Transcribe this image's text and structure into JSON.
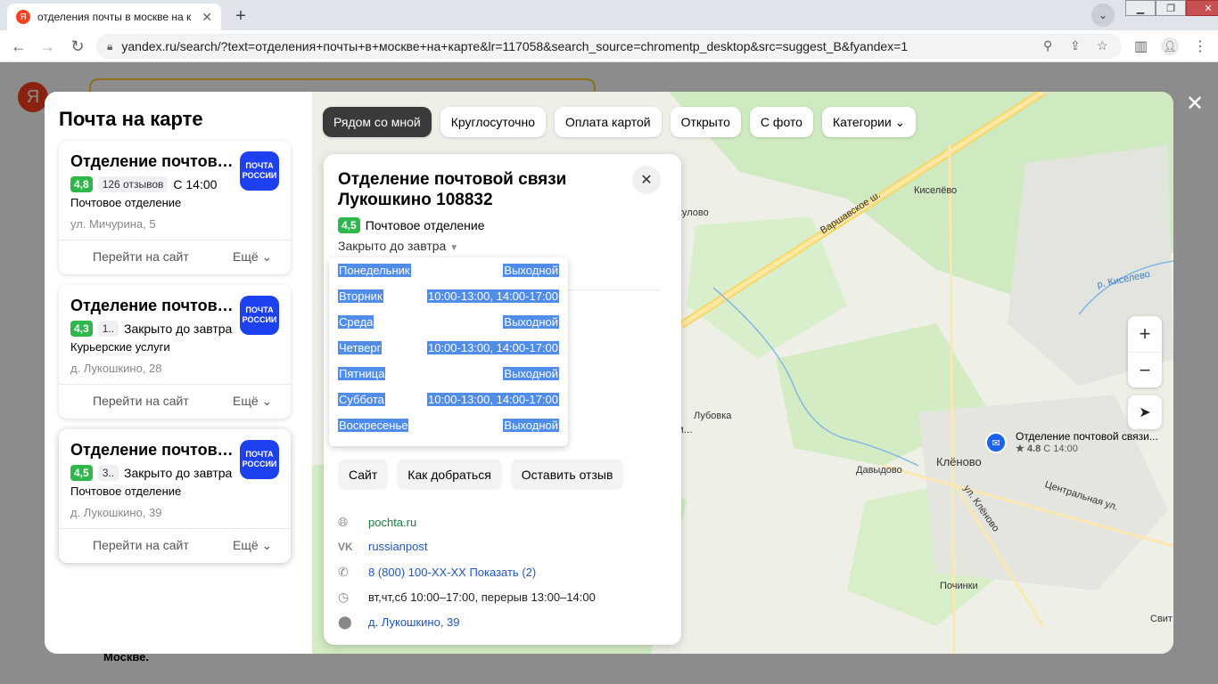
{
  "browser": {
    "tab_title": "отделения почты в москве на к",
    "tab_favicon": "Я",
    "url": "yandex.ru/search/?text=отделения+почты+в+москве+на+карте&lr=117058&search_source=chromentp_desktop&src=suggest_B&fyandex=1"
  },
  "page": {
    "logo": "Я",
    "bottom_text": "Москве."
  },
  "sidebar": {
    "title": "Почта на карте",
    "cards": [
      {
        "title": "Отделение почтовой связи",
        "rating": "4,8",
        "reviews": "126 отзывов",
        "status": "С 14:00",
        "category": "Почтовое отделение",
        "address": "ул. Мичурина, 5",
        "site": "Перейти на сайт",
        "more": "Ещё"
      },
      {
        "title": "Отделение почтовой связи",
        "rating": "4,3",
        "reviews": "1..",
        "status": "Закрыто до завтра",
        "category": "Курьерские услуги",
        "address": "д. Лукошкино, 28",
        "site": "Перейти на сайт",
        "more": "Ещё"
      },
      {
        "title": "Отделение почтовой связи",
        "rating": "4,5",
        "reviews": "3..",
        "status": "Закрыто до завтра",
        "category": "Почтовое отделение",
        "address": "д. Лукошкино, 39",
        "site": "Перейти на сайт",
        "more": "Ещё"
      }
    ],
    "logo_line1": "ПОЧТА",
    "logo_line2": "РОССИИ"
  },
  "filters": [
    "Рядом со мной",
    "Круглосуточно",
    "Оплата картой",
    "Открыто",
    "С фото",
    "Категории"
  ],
  "map_labels": {
    "kiselevo": "Киселёво",
    "varshavskoe": "Варшавское ш.",
    "kulovo": "кулово",
    "kiselevo_river": "р. Киселево",
    "lubovka": "Лубовка",
    "davydovo": "Давыдово",
    "klenovo": "Клёново",
    "ul_klenovo": "ул. Клёново",
    "centralnaya": "Центральная ул.",
    "pochinki": "Починки",
    "svit": "Свит",
    "ellipsis": "и..."
  },
  "map_pin": {
    "label": "Отделение почтовой связи...",
    "rating": "★ 4.8",
    "status": "С 14:00"
  },
  "detail": {
    "title": "Отделение почтовой связи Лукошкино 108832",
    "rating": "4,5",
    "category": "Почтовое отделение",
    "status": "Закрыто до завтра",
    "buttons": [
      "Сайт",
      "Как добраться",
      "Оставить отзыв"
    ],
    "website": "pochta.ru",
    "vk": "russianpost",
    "phone": "8 (800) 100-XX-XX Показать (2)",
    "hours_summary": "вт,чт,сб 10:00–17:00, перерыв 13:00–14:00",
    "address": "д. Лукошкино, 39"
  },
  "schedule": [
    {
      "day": "Понедельник",
      "hours": "Выходной"
    },
    {
      "day": "Вторник",
      "hours": "10:00-13:00, 14:00-17:00"
    },
    {
      "day": "Среда",
      "hours": "Выходной"
    },
    {
      "day": "Четверг",
      "hours": "10:00-13:00, 14:00-17:00"
    },
    {
      "day": "Пятница",
      "hours": "Выходной"
    },
    {
      "day": "Суббота",
      "hours": "10:00-13:00, 14:00-17:00"
    },
    {
      "day": "Воскресенье",
      "hours": "Выходной"
    }
  ],
  "colors": {
    "accent_green": "#2eb84b",
    "post_blue": "#1d41ef",
    "yandex_red": "#fc3f1d",
    "selection": "#4f8de8"
  }
}
